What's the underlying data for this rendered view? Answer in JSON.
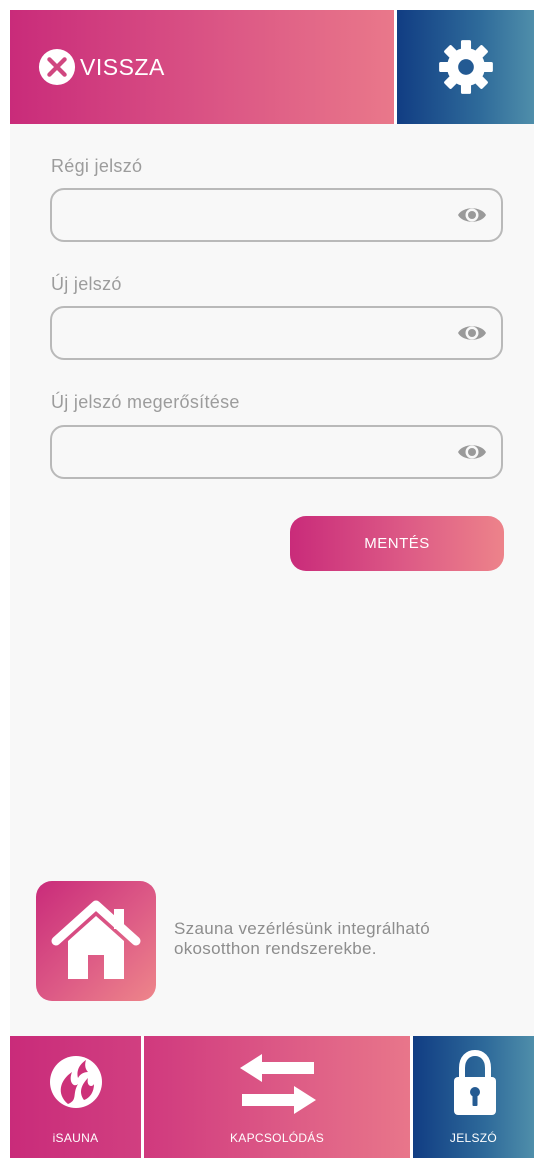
{
  "header": {
    "back_label": "VISSZA",
    "back_icon": "close-circle-icon",
    "settings_icon": "gear-icon"
  },
  "form": {
    "fields": [
      {
        "label": "Régi jelszó",
        "value": "",
        "placeholder": ""
      },
      {
        "label": "Új jelszó",
        "value": "",
        "placeholder": ""
      },
      {
        "label": "Új jelszó megerősítése",
        "value": "",
        "placeholder": ""
      }
    ],
    "visibility_icon": "eye-icon",
    "save_label": "MENTÉS"
  },
  "promo": {
    "icon": "home-icon",
    "line1": "Szauna vezérlésünk integrálható",
    "line2": "okosotthon rendszerekbe."
  },
  "bottom_nav": {
    "items": [
      {
        "label": "iSAUNA",
        "icon": "isauna-logo-icon"
      },
      {
        "label": "KAPCSOLÓDÁS",
        "icon": "swap-arrows-icon"
      },
      {
        "label": "JELSZÓ",
        "icon": "lock-icon"
      }
    ]
  },
  "colors": {
    "pink_start": "#c92b7a",
    "pink_end": "#ee868a",
    "blue_start": "#113d83",
    "blue_end": "#4f8eaa",
    "background": "#f8f8f8",
    "label_gray": "#9c9c9c",
    "border_gray": "#b9b9b9"
  }
}
